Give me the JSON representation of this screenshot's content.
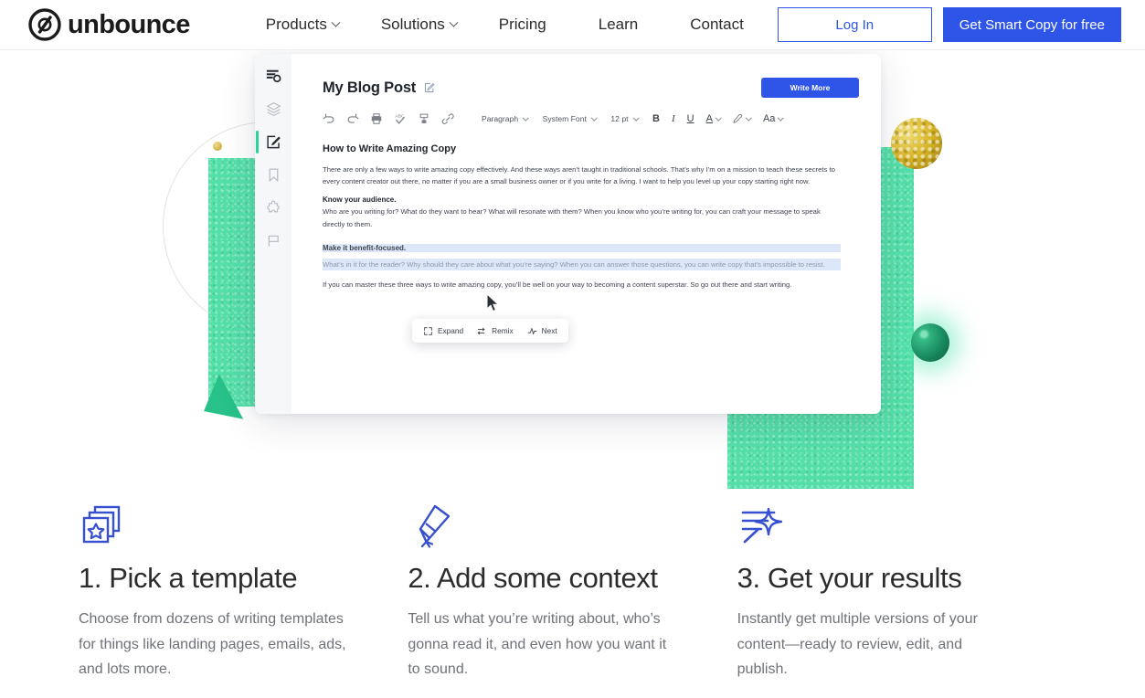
{
  "nav": {
    "logo_text": "unbounce",
    "logo_icon": "unbounce-circle-slash-logo",
    "links": [
      {
        "label": "Products",
        "has_chevron": true
      },
      {
        "label": "Solutions",
        "has_chevron": true
      },
      {
        "label": "Pricing",
        "has_chevron": false
      },
      {
        "label": "Learn",
        "has_chevron": false
      },
      {
        "label": "Contact",
        "has_chevron": false
      }
    ],
    "login_label": "Log In",
    "cta_label": "Get Smart Copy for free",
    "accent_color": "#2f55e8"
  },
  "app": {
    "sidebar_icons": [
      "document-settings-icon",
      "layers-icon",
      "edit-square-icon",
      "bookmark-icon",
      "puzzle-piece-icon",
      "flag-icon"
    ],
    "doc_title": "My Blog Post",
    "title_edit_icon": "edit-pencil-square-icon",
    "write_more_label": "Write More",
    "toolbar": {
      "icons": [
        "undo-icon",
        "redo-icon",
        "print-icon",
        "spellcheck-icon",
        "clear-formatting-icon",
        "link-icon"
      ],
      "style_select": "Paragraph",
      "font_select": "System Font",
      "size_select": "12 pt",
      "bold_label": "B",
      "italic_label": "I",
      "underline_label": "U",
      "text_color_label": "A",
      "highlight_icon": "highlighter-pen-icon",
      "text_case_label": "Aa"
    },
    "document": {
      "heading": "How to Write Amazing Copy",
      "paragraph_1": "There are only a few ways to write amazing copy effectively. And these ways aren’t taught in traditional schools. That’s why I’m on a mission to teach these secrets to every content creator out there, no matter if you are a small business owner or if you write for a living. I want to help you level up your copy starting right now.",
      "subhead_1": "Know your audience.",
      "paragraph_2": "Who are you writing for? What do they want to hear? What will resonate with them? When you know who you’re writing for, you can craft your message to speak directly to them.",
      "subhead_2": "Make it benefit-focused.",
      "paragraph_3": "What’s in it for the reader? Why should they care about what you’re saying? When you can answer those questions, you can write copy that’s impossible to resist.",
      "paragraph_4": "If you can master these three ways to write amazing copy, you’ll be well on your way to becoming a content superstar. So go out there and start writing."
    },
    "float_toolbar": [
      {
        "label": "Expand",
        "icon": "expand-arrows-icon"
      },
      {
        "label": "Remix",
        "icon": "shuffle-arrows-icon"
      },
      {
        "label": "Next",
        "icon": "pulse-wave-icon"
      }
    ]
  },
  "features": [
    {
      "icon": "stacked-cards-star-icon",
      "heading": "1. Pick a template",
      "body": "Choose from dozens of writing templates for things like landing pages, emails, ads, and lots more."
    },
    {
      "icon": "pencil-writing-sparkle-icon",
      "heading": "2. Add some context",
      "body": "Tell us what you’re writing about, who’s gonna read it, and even how you want it to sound."
    },
    {
      "icon": "lines-sparkle-results-icon",
      "heading": "3. Get your results",
      "body": "Instantly get multiple versions of your content—ready to review, edit, and publish."
    }
  ],
  "decor": {
    "green": "#54dfa8",
    "dark_green": "#27c189",
    "gold": "#d8b62a"
  }
}
